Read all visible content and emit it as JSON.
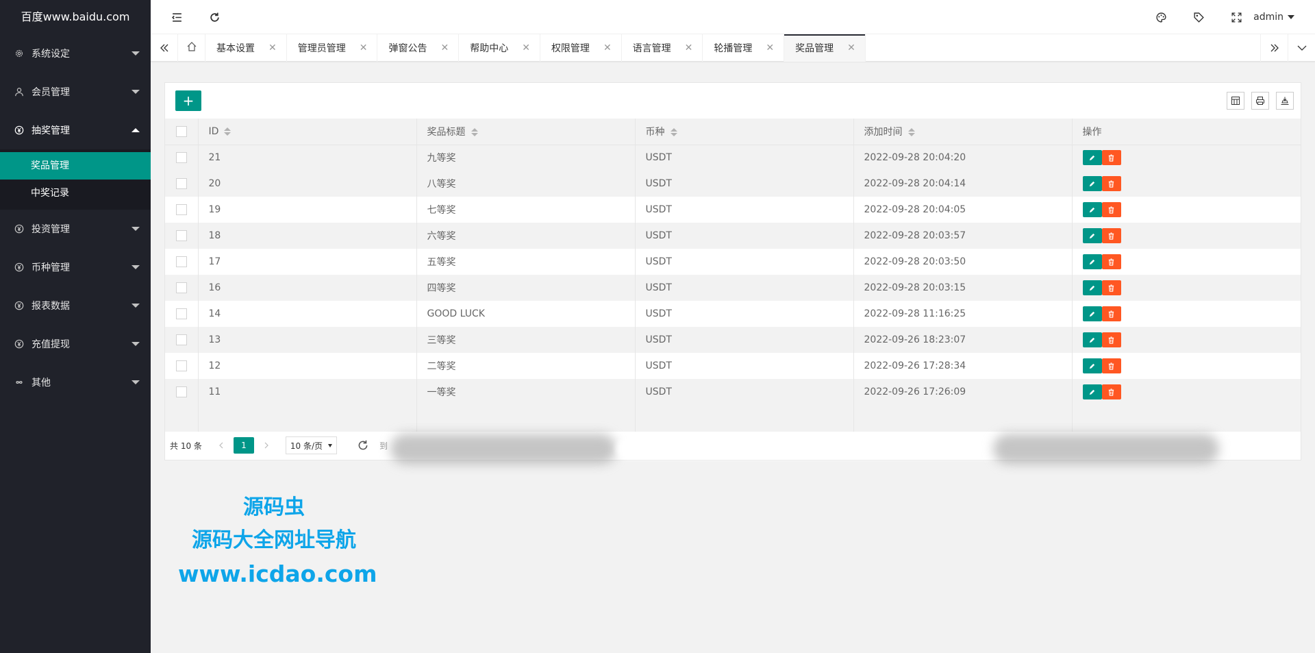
{
  "logo": "百度www.baidu.com",
  "sidebar": {
    "items": [
      {
        "label": "系统设定",
        "icon": "gear-icon"
      },
      {
        "label": "会员管理",
        "icon": "user-icon"
      },
      {
        "label": "抽奖管理",
        "icon": "yen-circle-icon"
      },
      {
        "label": "投资管理",
        "icon": "yen-circle-icon"
      },
      {
        "label": "币种管理",
        "icon": "yen-circle-icon"
      },
      {
        "label": "报表数据",
        "icon": "yen-circle-icon"
      },
      {
        "label": "充值提现",
        "icon": "yen-circle-icon"
      },
      {
        "label": "其他",
        "icon": "infinity-icon"
      }
    ],
    "subitems": [
      {
        "label": "奖品管理",
        "active": true
      },
      {
        "label": "中奖记录",
        "active": false
      }
    ]
  },
  "header": {
    "user": "admin",
    "icons": [
      "menu-fold-icon",
      "refresh-icon",
      "palette-icon",
      "tag-icon",
      "fullscreen-icon"
    ]
  },
  "tabs": [
    {
      "label": "基本设置"
    },
    {
      "label": "管理员管理"
    },
    {
      "label": "弹窗公告"
    },
    {
      "label": "帮助中心"
    },
    {
      "label": "权限管理"
    },
    {
      "label": "语言管理"
    },
    {
      "label": "轮播管理"
    },
    {
      "label": "奖品管理",
      "active": true
    }
  ],
  "toolbar": {
    "add_label": "+"
  },
  "table": {
    "columns": [
      "ID",
      "奖品标题",
      "币种",
      "添加时间",
      "操作"
    ],
    "rows": [
      {
        "id": "21",
        "title": "九等奖",
        "currency": "USDT",
        "time": "2022-09-28 20:04:20"
      },
      {
        "id": "20",
        "title": "八等奖",
        "currency": "USDT",
        "time": "2022-09-28 20:04:14"
      },
      {
        "id": "19",
        "title": "七等奖",
        "currency": "USDT",
        "time": "2022-09-28 20:04:05"
      },
      {
        "id": "18",
        "title": "六等奖",
        "currency": "USDT",
        "time": "2022-09-28 20:03:57"
      },
      {
        "id": "17",
        "title": "五等奖",
        "currency": "USDT",
        "time": "2022-09-28 20:03:50"
      },
      {
        "id": "16",
        "title": "四等奖",
        "currency": "USDT",
        "time": "2022-09-28 20:03:15"
      },
      {
        "id": "14",
        "title": "GOOD LUCK",
        "currency": "USDT",
        "time": "2022-09-28 11:16:25"
      },
      {
        "id": "13",
        "title": "三等奖",
        "currency": "USDT",
        "time": "2022-09-26 18:23:07"
      },
      {
        "id": "12",
        "title": "二等奖",
        "currency": "USDT",
        "time": "2022-09-26 17:28:34"
      },
      {
        "id": "11",
        "title": "一等奖",
        "currency": "USDT",
        "time": "2022-09-26 17:26:09"
      }
    ]
  },
  "pager": {
    "total": "共 10 条",
    "current": "1",
    "page_size": "10 条/页",
    "goto": "到"
  },
  "watermark": {
    "line1": "源码虫",
    "line2": "源码大全网址导航",
    "line3": "www.icdao.com"
  },
  "colors": {
    "primary": "#009688",
    "danger": "#ff5722",
    "sidebar_bg": "#20222a",
    "watermark": "#0ea5e9"
  }
}
